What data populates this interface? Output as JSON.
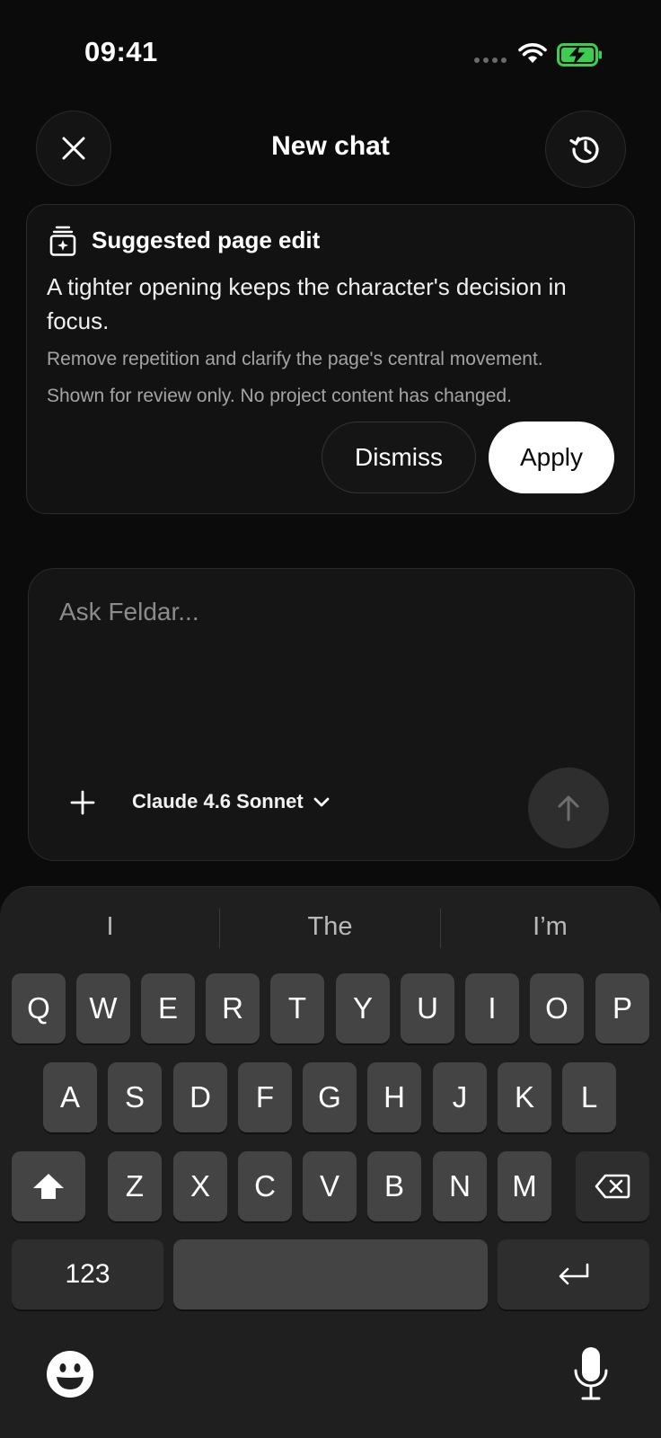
{
  "status_bar": {
    "time": "09:41"
  },
  "header": {
    "title": "New chat"
  },
  "suggestion": {
    "title": "Suggested page edit",
    "body": "A tighter opening keeps the character's decision in focus.",
    "detail": "Remove repetition and clarify the page's central movement.",
    "review_note": "Shown for review only. No project content has changed.",
    "dismiss_label": "Dismiss",
    "apply_label": "Apply"
  },
  "composer": {
    "placeholder": "Ask Feldar...",
    "model": "Claude 4.6 Sonnet"
  },
  "keyboard": {
    "predictions": [
      "I",
      "The",
      "I’m"
    ],
    "row1": [
      "Q",
      "W",
      "E",
      "R",
      "T",
      "Y",
      "U",
      "I",
      "O",
      "P"
    ],
    "row2": [
      "A",
      "S",
      "D",
      "F",
      "G",
      "H",
      "J",
      "K",
      "L"
    ],
    "row3": [
      "Z",
      "X",
      "C",
      "V",
      "B",
      "N",
      "M"
    ],
    "numbers_label": "123"
  },
  "icons": {
    "close": "close-icon",
    "history": "history-icon",
    "card": "page-edit-icon",
    "plus": "plus-icon",
    "chevron": "chevron-down-icon",
    "send": "arrow-up-icon",
    "shift": "shift-icon",
    "backspace": "backspace-icon",
    "return": "return-icon",
    "emoji": "emoji-icon",
    "mic": "microphone-icon"
  },
  "colors": {
    "background": "#0b0b0b",
    "battery_charging": "#3ccf4e",
    "apply_bg": "#ffffff"
  }
}
